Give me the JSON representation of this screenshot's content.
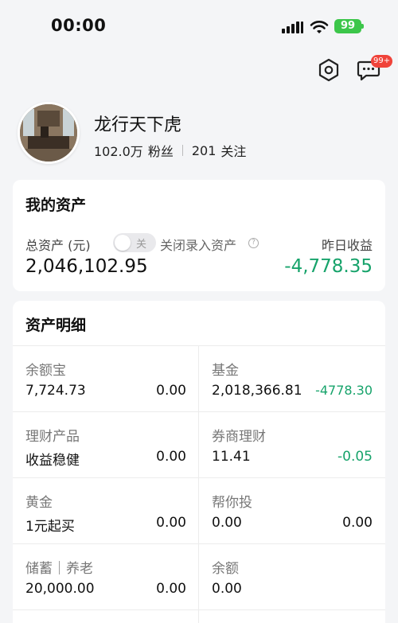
{
  "status_bar": {
    "time": "00:00",
    "battery": "99"
  },
  "header": {
    "message_badge": "99+"
  },
  "profile": {
    "username": "龙行天下虎",
    "fans_count": "102.0万",
    "fans_label": "粉丝",
    "following_count": "201",
    "following_label": "关注"
  },
  "assets": {
    "title": "我的资产",
    "total_label": "总资产 (元)",
    "toggle_text": "关",
    "toggle_desc": "关闭录入资产",
    "total_value": "2,046,102.95",
    "yesterday_label": "昨日收益",
    "yesterday_value": "-4,778.35"
  },
  "details": {
    "title": "资产明细",
    "cells": [
      {
        "name": "余额宝",
        "sub": "7,724.73",
        "value": "0.00"
      },
      {
        "name": "基金",
        "sub": "2,018,366.81",
        "value": "-4778.30"
      },
      {
        "name": "理财产品",
        "sub": "收益稳健",
        "value": "0.00"
      },
      {
        "name": "券商理财",
        "sub": "11.41",
        "value": "-0.05"
      },
      {
        "name": "黄金",
        "sub": "1元起买",
        "value": "0.00"
      },
      {
        "name": "帮你投",
        "sub": "0.00",
        "value": "0.00"
      },
      {
        "name": "储蓄｜养老",
        "sub": "20,000.00",
        "value": "0.00"
      },
      {
        "name": "余额",
        "sub": "0.00",
        "value": ""
      }
    ]
  },
  "colors": {
    "green": "#17a36b",
    "badge_red": "#f0433a",
    "battery_green": "#3cc64a"
  },
  "icons": [
    "signal-icon",
    "wifi-icon",
    "battery-icon",
    "settings-hex-icon",
    "message-icon",
    "help-icon"
  ]
}
